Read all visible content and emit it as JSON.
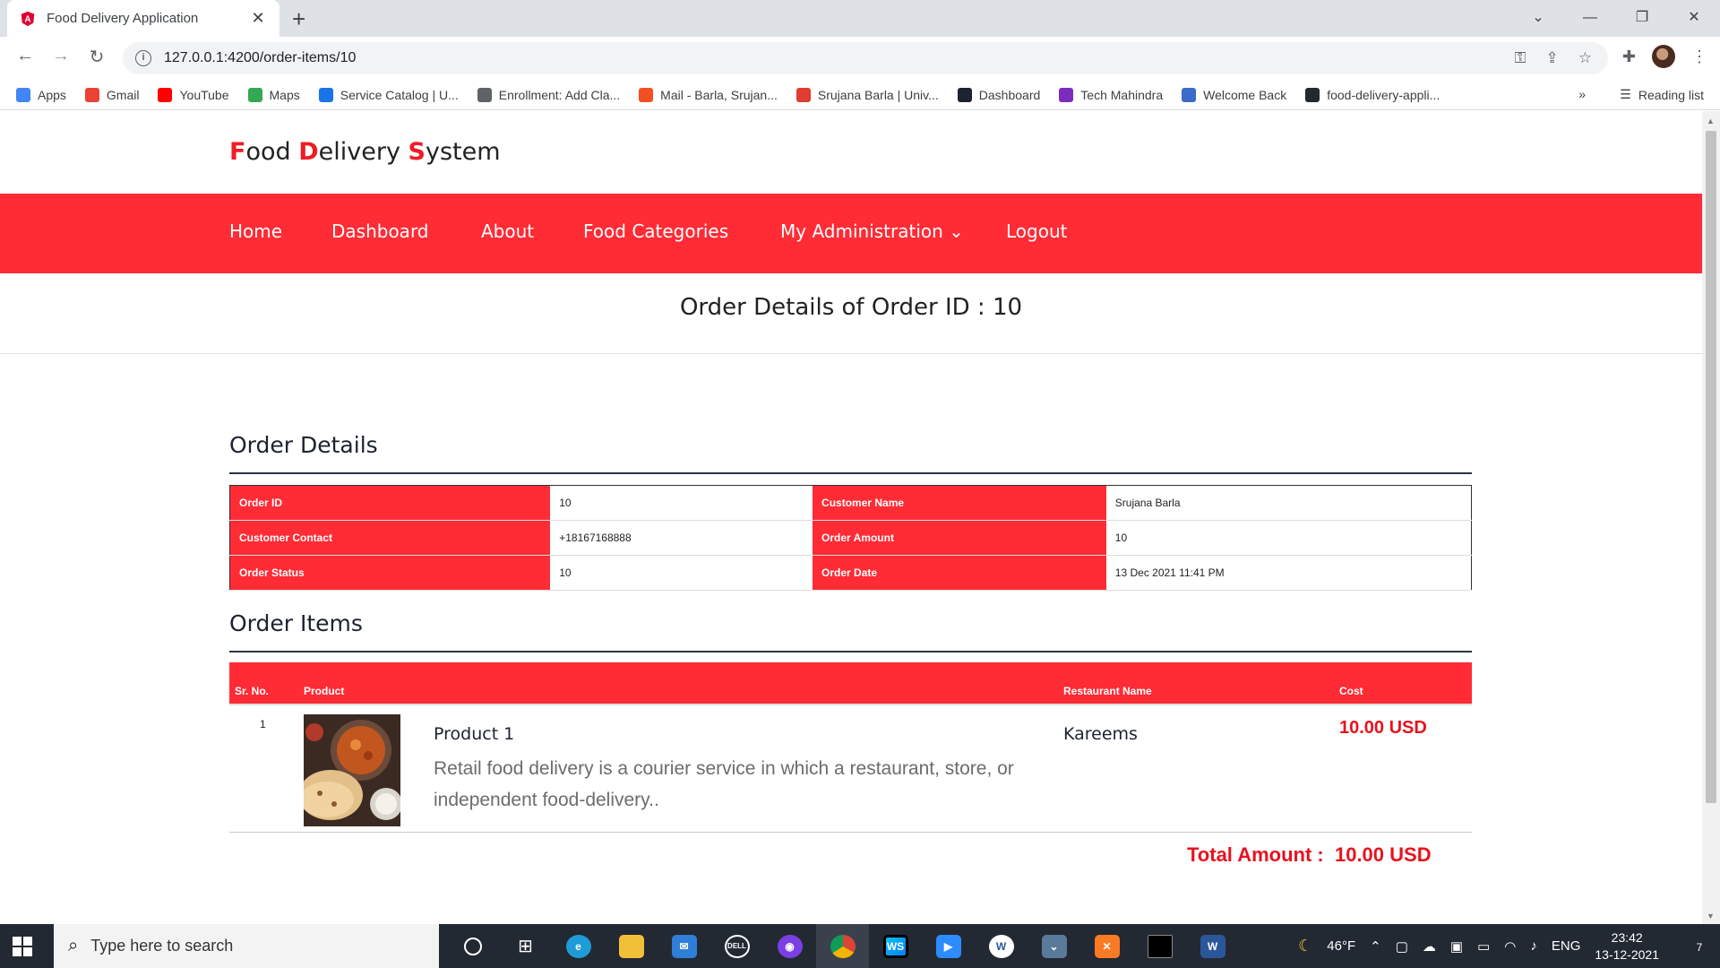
{
  "browser": {
    "tab_title": "Food Delivery Application",
    "tab_close": "✕",
    "new_tab": "+",
    "url": "127.0.0.1:4200/order-items/10",
    "bookmarks": [
      {
        "label": "Apps",
        "color": "#4285f4"
      },
      {
        "label": "Gmail",
        "color": "#ea4335"
      },
      {
        "label": "YouTube",
        "color": "#ff0000"
      },
      {
        "label": "Maps",
        "color": "#34a853"
      },
      {
        "label": "Service Catalog | U...",
        "color": "#1a73e8"
      },
      {
        "label": "Enrollment: Add Cla...",
        "color": "#5f6368"
      },
      {
        "label": "Mail - Barla, Srujan...",
        "color": "#f25022"
      },
      {
        "label": "Srujana Barla | Univ...",
        "color": "#e03c31"
      },
      {
        "label": "Dashboard",
        "color": "#1d2230"
      },
      {
        "label": "Tech Mahindra",
        "color": "#7b2cbf"
      },
      {
        "label": "Welcome Back",
        "color": "#3b6cc9"
      },
      {
        "label": "food-delivery-appli...",
        "color": "#24292e"
      }
    ],
    "bookmarks_more": "»",
    "reading_list": "Reading list"
  },
  "site": {
    "brand": {
      "l1": "F",
      "r1": "ood ",
      "l2": "D",
      "r2": "elivery ",
      "l3": "S",
      "r3": "ystem"
    },
    "nav": {
      "home": "Home",
      "dashboard": "Dashboard",
      "about": "About",
      "food_categories": "Food Categories",
      "my_administration": "My Administration ⌄",
      "logout": "Logout"
    },
    "page_title": "Order Details of Order ID : 10",
    "brand_color": "#ff2b35"
  },
  "order_details": {
    "heading": "Order Details",
    "rows": [
      {
        "k1": "Order ID",
        "v1": "10",
        "k2": "Customer Name",
        "v2": "Srujana Barla"
      },
      {
        "k1": "Customer Contact",
        "v1": "+18167168888",
        "k2": "Order Amount",
        "v2": "10"
      },
      {
        "k1": "Order Status",
        "v1": "10",
        "k2": "Order Date",
        "v2": "13 Dec 2021 11:41 PM"
      }
    ]
  },
  "order_items": {
    "heading": "Order Items",
    "columns": {
      "sr": "Sr. No.",
      "product": "Product",
      "restaurant": "Restaurant Name",
      "cost": "Cost"
    },
    "items": [
      {
        "sr": "1",
        "product_name": "Product 1",
        "description": "Retail food delivery is a courier service in which a restaurant, store, or independent food-delivery..",
        "restaurant": "Kareems",
        "cost": "10.00 USD"
      }
    ],
    "total": "Total Amount :  10.00 USD"
  },
  "taskbar": {
    "search_placeholder": "Type here to search",
    "weather": "46°F",
    "language": "ENG",
    "time": "23:42",
    "date": "13-12-2021",
    "notifications": "7"
  }
}
